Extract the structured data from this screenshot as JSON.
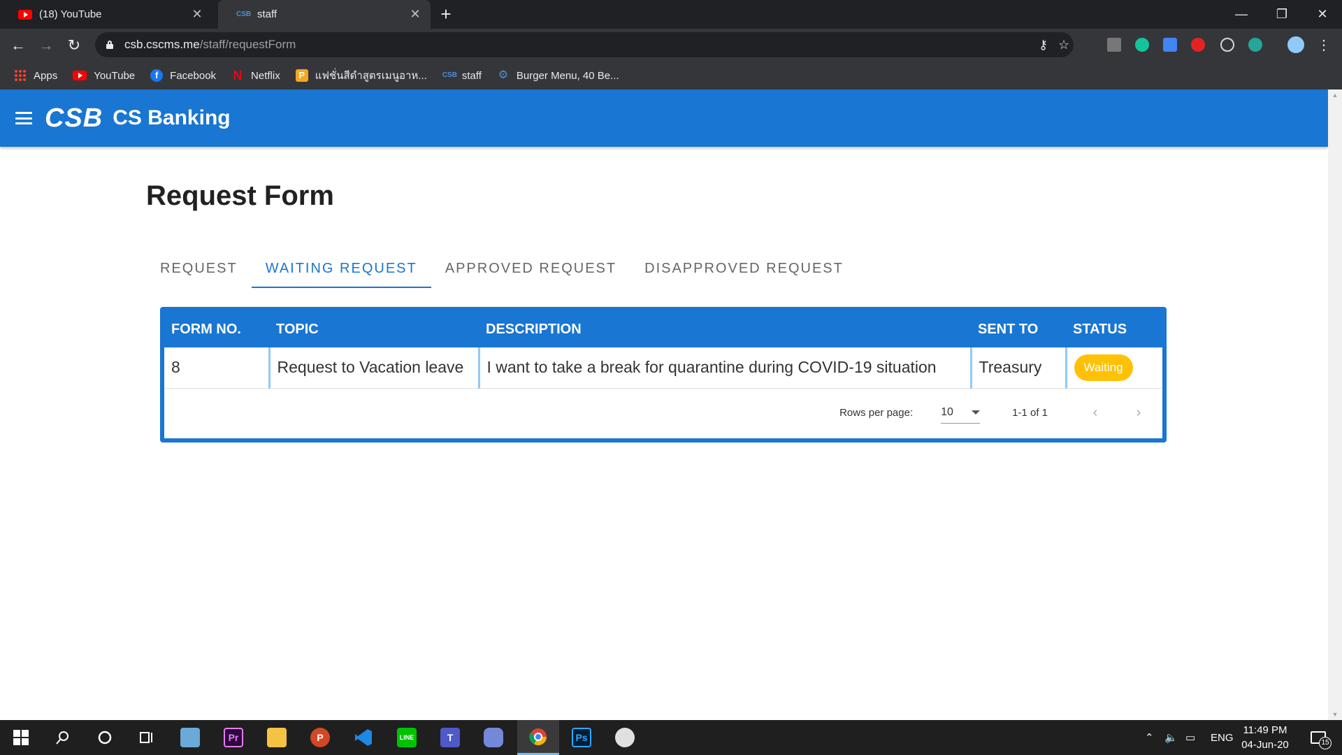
{
  "browser": {
    "tabs": [
      {
        "title": "(18) YouTube",
        "favicon": "youtube-icon",
        "active": false
      },
      {
        "title": "staff",
        "favicon": "csb-icon",
        "active": true
      }
    ],
    "url_host": "csb.cscms.me",
    "url_path": "/staff/requestForm",
    "bookmarks": [
      {
        "label": "Apps",
        "icon": "apps-icon"
      },
      {
        "label": "YouTube",
        "icon": "youtube-icon"
      },
      {
        "label": "Facebook",
        "icon": "facebook-icon"
      },
      {
        "label": "Netflix",
        "icon": "netflix-icon"
      },
      {
        "label": "แฟชั่นสีดำสูตรเมนูอาห...",
        "icon": "p-icon"
      },
      {
        "label": "staff",
        "icon": "csb-icon"
      },
      {
        "label": "Burger Menu, 40 Be...",
        "icon": "burger-icon"
      }
    ],
    "favicon_text": "CSB"
  },
  "app": {
    "logo": "CSB",
    "name": "CS Banking",
    "page_title": "Request Form",
    "tabs": [
      {
        "label": "REQUEST",
        "active": false
      },
      {
        "label": "WAITING REQUEST",
        "active": true
      },
      {
        "label": "APPROVED REQUEST",
        "active": false
      },
      {
        "label": "DISAPPROVED REQUEST",
        "active": false
      }
    ],
    "table": {
      "headers": [
        "FORM NO.",
        "TOPIC",
        "DESCRIPTION",
        "SENT TO",
        "STATUS"
      ],
      "rows": [
        {
          "form_no": "8",
          "topic": "Request to Vacation leave",
          "description": "I want to take a break for quarantine during COVID-19 situation",
          "sent_to": "Treasury",
          "status": "Waiting"
        }
      ]
    },
    "pagination": {
      "rows_per_page_label": "Rows per page:",
      "rows_per_page": "10",
      "range": "1-1 of 1"
    }
  },
  "taskbar": {
    "language": "ENG",
    "time": "11:49 PM",
    "date": "04-Jun-20",
    "notification_count": "15",
    "apps": [
      "windows-start-icon",
      "search-icon",
      "cortana-icon",
      "task-view-icon",
      "notepad-icon",
      "premiere-icon",
      "file-explorer-icon",
      "powerpoint-icon",
      "vscode-icon",
      "line-icon",
      "teams-icon",
      "discord-icon",
      "chrome-icon",
      "photoshop-icon",
      "paint-icon"
    ],
    "premiere_label": "Pr",
    "photoshop_label": "Ps",
    "powerpoint_label": "P",
    "line_label": "LINE",
    "teams_label": "T"
  },
  "colors": {
    "primary": "#1976d2",
    "status_waiting": "#ffc107"
  }
}
